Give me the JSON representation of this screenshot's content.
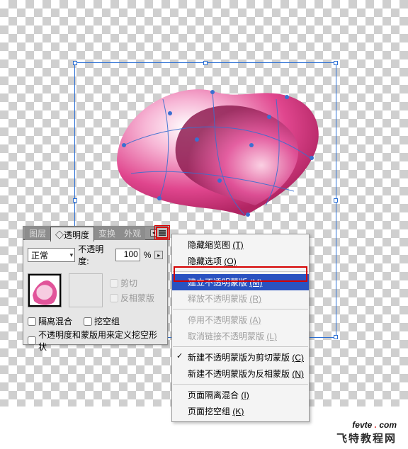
{
  "footer": {
    "brand": "fevte",
    "tld": "com",
    "dot": " . ",
    "tagline": "飞特教程网"
  },
  "panel": {
    "tabs": {
      "layers": "图层",
      "trans_prefix": "◇",
      "transparency": "透明度",
      "transform": "变换",
      "appearance": "外观"
    },
    "blend_mode": "正常",
    "opacity_label": "不透明度:",
    "opacity_value": "100",
    "percent": "%",
    "clip": "剪切",
    "invert_mask": "反相蒙版",
    "isolate": "隔离混合",
    "knockout": "挖空组",
    "desc": "不透明度和蒙版用来定义挖空形状"
  },
  "menu": {
    "hide_thumbs": "隐藏缩览图",
    "hide_thumbs_k": "(T)",
    "hide_options": "隐藏选项",
    "hide_options_k": "(O)",
    "make_mask": "建立不透明蒙版",
    "make_mask_k": "(M)",
    "release_mask": "释放不透明蒙版",
    "release_mask_k": "(R)",
    "disable_mask": "停用不透明蒙版",
    "disable_mask_k": "(A)",
    "unlink_mask": "取消链接不透明蒙版",
    "unlink_mask_k": "(L)",
    "new_clip": "新建不透明蒙版为剪切蒙版",
    "new_clip_k": "(C)",
    "new_invert": "新建不透明蒙版为反相蒙版",
    "new_invert_k": "(N)",
    "page_isolate": "页面隔离混合",
    "page_isolate_k": "(I)",
    "page_knockout": "页面挖空组",
    "page_knockout_k": "(K)"
  }
}
